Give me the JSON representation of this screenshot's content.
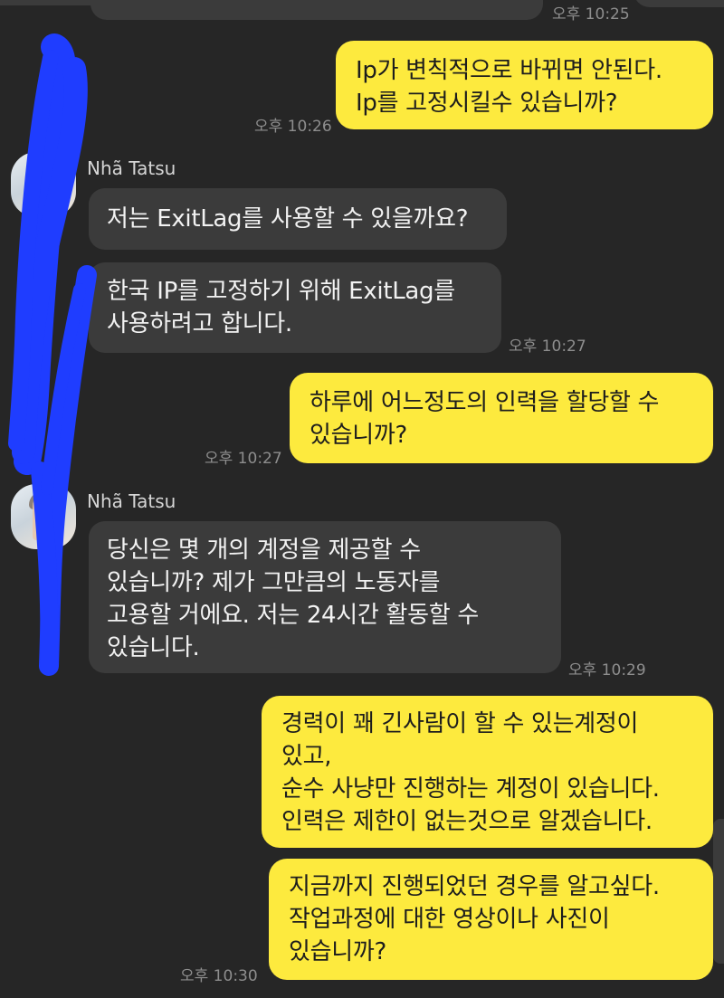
{
  "messages": [
    {
      "id": "m1",
      "direction": "outgoing",
      "text": "Ip가 변칙적으로 바뀌면 안된다.\nIp를 고정시킬수 있습니까?",
      "time": "오후 10:26"
    },
    {
      "id": "m2",
      "direction": "incoming",
      "sender": "Nhã Tatsu",
      "text": "저는 ExitLag를 사용할 수 있을까요?"
    },
    {
      "id": "m3",
      "direction": "incoming",
      "text": "한국 IP를 고정하기 위해 ExitLag를\n사용하려고 합니다.",
      "time": "오후 10:27"
    },
    {
      "id": "m4",
      "direction": "outgoing",
      "text": "하루에 어느정도의 인력을 할당할 수\n있습니까?",
      "time": "오후 10:27"
    },
    {
      "id": "m5",
      "direction": "incoming",
      "sender": "Nhã Tatsu",
      "text": "당신은 몇 개의 계정을 제공할 수\n있습니까? 제가 그만큼의 노동자를\n고용할 거에요. 저는 24시간 활동할 수\n있습니다.",
      "time": "오후 10:29"
    },
    {
      "id": "m6",
      "direction": "outgoing",
      "text": "경력이 꽤 긴사람이 할 수 있는계정이\n있고,\n순수 사냥만 진행하는 계정이 있습니다.\n인력은 제한이 없는것으로 알겠습니다."
    },
    {
      "id": "m7",
      "direction": "outgoing",
      "text": "지금까지 진행되었던 경우를 알고싶다.\n작업과정에 대한 영상이나 사진이\n있습니까?",
      "time": "오후 10:30"
    }
  ],
  "partial_top": {
    "time": "오후 10:25"
  },
  "colors": {
    "background": "#262626",
    "incoming_bubble": "#3b3b3b",
    "outgoing_bubble": "#fdea3e",
    "redaction_scribble": "#1f3dff"
  }
}
